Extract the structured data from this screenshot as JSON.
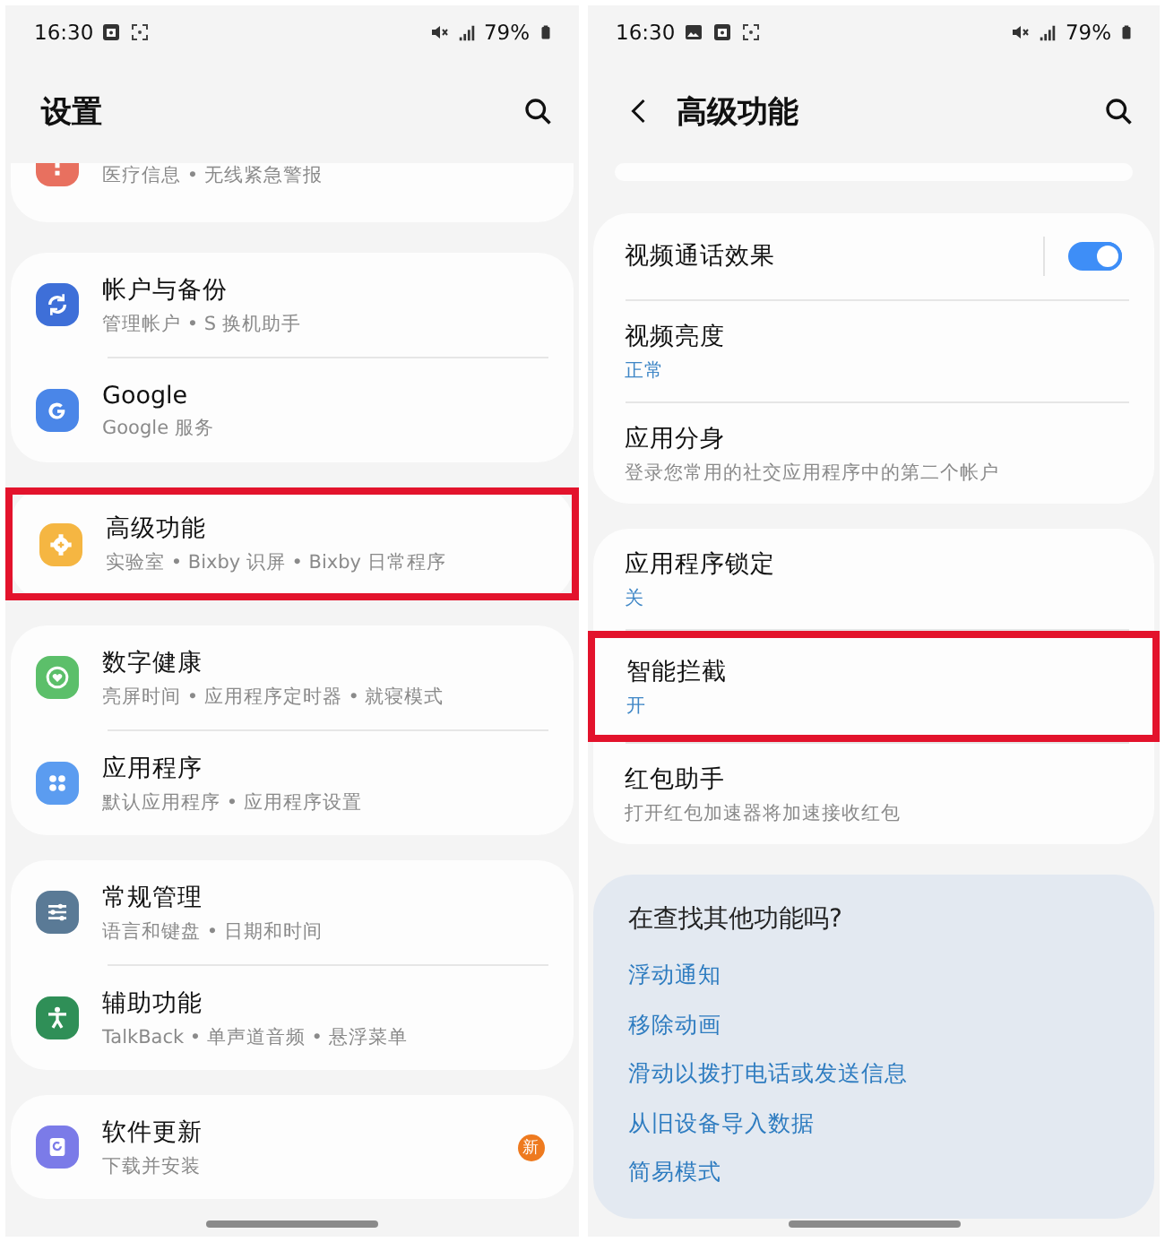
{
  "panels": [
    {
      "status_bar": {
        "time": "16:30",
        "battery": "79%"
      },
      "header": {
        "title": "设置",
        "back": false
      },
      "groups": [
        {
          "kind": "clipped",
          "items": [
            {
              "kind": "nav",
              "color": "#e8705f",
              "subtitle": "医疗信息 • 无线紧急警报",
              "highlighted": false
            }
          ]
        },
        {
          "kind": "card",
          "items": [
            {
              "kind": "nav",
              "color": "#3e6fd8",
              "title": "帐户与备份",
              "subtitle": "管理帐户 • S 换机助手",
              "highlighted": false
            },
            {
              "kind": "nav",
              "color": "#4a86e8",
              "title": "Google",
              "subtitle": "Google 服务",
              "highlighted": false
            }
          ]
        },
        {
          "kind": "card",
          "items": [
            {
              "kind": "nav",
              "color": "#f5b642",
              "title": "高级功能",
              "subtitle": "实验室 • Bixby 识屏 • Bixby 日常程序",
              "highlighted": true
            }
          ]
        },
        {
          "kind": "card",
          "items": [
            {
              "kind": "nav",
              "color": "#5cbf6a",
              "title": "数字健康",
              "subtitle": "亮屏时间 • 应用程序定时器 • 就寝模式",
              "highlighted": false
            },
            {
              "kind": "nav",
              "color": "#5b9cf0",
              "title": "应用程序",
              "subtitle": "默认应用程序 • 应用程序设置",
              "highlighted": false
            }
          ]
        },
        {
          "kind": "card",
          "items": [
            {
              "kind": "nav",
              "color": "#5a7a96",
              "title": "常规管理",
              "subtitle": "语言和键盘 • 日期和时间",
              "highlighted": false
            },
            {
              "kind": "nav",
              "color": "#2f8f57",
              "title": "辅助功能",
              "subtitle": "TalkBack • 单声道音频 • 悬浮菜单",
              "highlighted": false
            }
          ]
        },
        {
          "kind": "card",
          "items": [
            {
              "kind": "nav",
              "color": "#7b7be8",
              "title": "软件更新",
              "subtitle": "下载并安装",
              "badge": "新",
              "highlighted": false
            }
          ]
        }
      ]
    },
    {
      "status_bar": {
        "time": "16:30",
        "battery": "79%"
      },
      "header": {
        "title": "高级功能",
        "back": true
      },
      "groups": [
        {
          "kind": "sliver"
        },
        {
          "kind": "card",
          "items": [
            {
              "kind": "toggle",
              "title": "视频通话效果",
              "on": true,
              "highlighted": false
            },
            {
              "kind": "status",
              "title": "视频亮度",
              "subtitle": "正常",
              "highlighted": false
            },
            {
              "kind": "description",
              "title": "应用分身",
              "subtitle": "登录您常用的社交应用程序中的第二个帐户",
              "highlighted": false
            }
          ]
        },
        {
          "kind": "card",
          "items": [
            {
              "kind": "status",
              "title": "应用程序锁定",
              "subtitle": "关",
              "highlighted": false
            },
            {
              "kind": "status",
              "title": "智能拦截",
              "subtitle": "开",
              "highlighted": true
            },
            {
              "kind": "description",
              "title": "红包助手",
              "subtitle": "打开红包加速器将加速接收红包",
              "highlighted": false
            }
          ]
        }
      ],
      "suggestions": {
        "heading": "在查找其他功能吗?",
        "links": [
          "浮动通知",
          "移除动画",
          "滑动以拨打电话或发送信息",
          "从旧设备导入数据",
          "简易模式"
        ]
      }
    }
  ]
}
